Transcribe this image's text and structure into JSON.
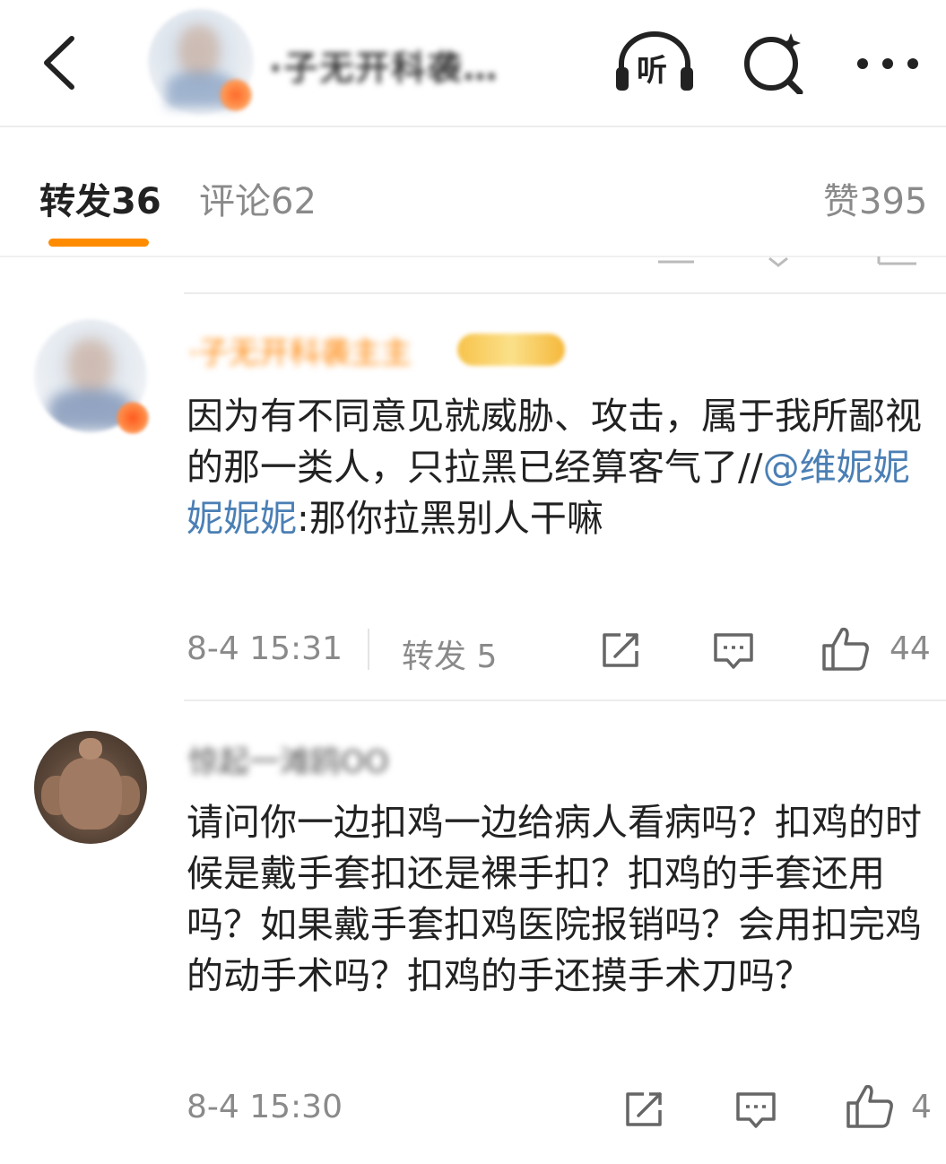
{
  "header": {
    "title": "·子无开科袭…",
    "listen_label": "听",
    "icons": [
      "back-arrow-icon",
      "headphones-icon",
      "search-sparkle-icon",
      "more-dots-icon"
    ]
  },
  "tabs": [
    {
      "label": "转发36",
      "active": true
    },
    {
      "label": "评论62",
      "active": false
    },
    {
      "label": "赞395",
      "active": false
    }
  ],
  "accent_color": "#ff8c00",
  "mention_color": "#4b7fb5",
  "comments": [
    {
      "username": "·子无开科袭主主",
      "text_before": "因为有不同意见就威胁、攻击，属于我所鄙视的那一类人，只拉黑已经算客气了//",
      "mention": "@维妮妮妮妮妮",
      "text_after": ":那你拉黑别人干嘛",
      "time": "8-4 15:31",
      "repost_label": "转发 5",
      "likes": "44"
    },
    {
      "username": "惊起一滩鸥OO",
      "text": "请问你一边扣鸡一边给病人看病吗？扣鸡的时候是戴手套扣还是裸手扣？扣鸡的手套还用吗？如果戴手套扣鸡医院报销吗？会用扣完鸡的动手术吗？扣鸡的手还摸手术刀吗？",
      "time": "8-4 15:30",
      "likes": "4"
    }
  ]
}
